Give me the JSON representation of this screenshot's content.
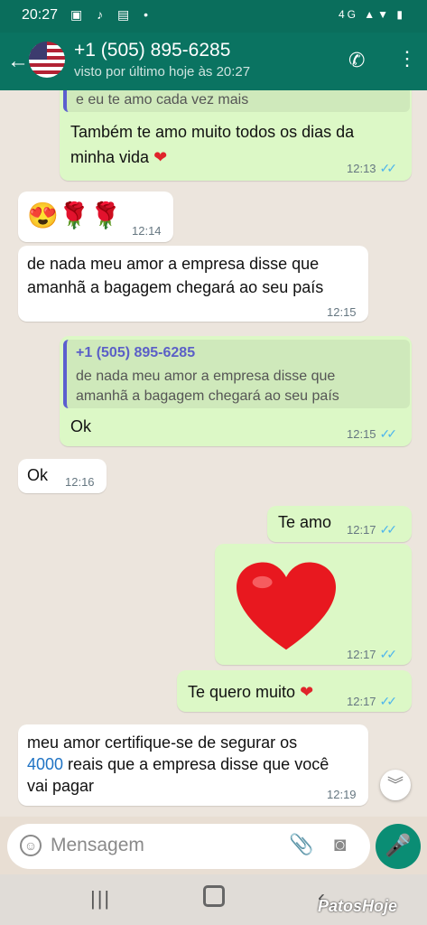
{
  "status": {
    "time": "20:27",
    "right": "4G ▲▼ ▮"
  },
  "header": {
    "title": "+1 (505) 895-6285",
    "subtitle": "visto por último hoje às 20:27"
  },
  "messages": {
    "m1": {
      "quote_tail": "e eu te amo cada vez mais",
      "text1": "Também te amo muito todos os dias da",
      "text2": "minha vida",
      "time": "12:13"
    },
    "m2": {
      "emojis": "😍🌹🌹",
      "time": "12:14"
    },
    "m3": {
      "text1": "de nada meu amor a empresa disse que",
      "text2": "amanhã a bagagem chegará ao seu país",
      "time": "12:15"
    },
    "m4": {
      "quote_name": "+1 (505) 895-6285",
      "quote1": "de nada meu amor a empresa disse que",
      "quote2": "amanhã a bagagem chegará ao seu país",
      "text": "Ok",
      "time": "12:15"
    },
    "m5": {
      "text": "Ok",
      "time": "12:16"
    },
    "m6": {
      "text": "Te amo",
      "time": "12:17"
    },
    "m7": {
      "time": "12:17"
    },
    "m8": {
      "text": "Te quero muito",
      "time": "12:17"
    },
    "m9": {
      "text1": "meu amor certifique-se de segurar os",
      "text2_link": "4000",
      "text2_rest": " reais que a empresa disse que você",
      "text3": "vai pagar",
      "time": "12:19"
    }
  },
  "input": {
    "placeholder": "Mensagem"
  },
  "watermark": "PatosHoje",
  "colors": {
    "header": "#0a7361",
    "outgoing": "#dcf8c6",
    "incoming": "#ffffff",
    "tick": "#4fb6ec",
    "mic": "#0a8d74"
  }
}
